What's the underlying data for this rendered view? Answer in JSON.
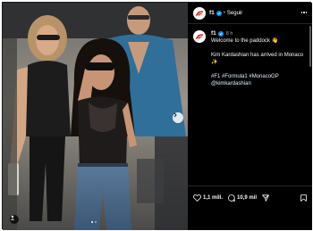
{
  "post": {
    "account": {
      "username": "f1",
      "follow_label": "Seguir",
      "separator": "•"
    },
    "caption": {
      "username": "f1",
      "time": "8 h",
      "line1": "Welcome to the paddock 👋",
      "line2": "Kim Kardashian has arrived in Monaco ✨",
      "hashtags": "#F1 #Formula1 #MonacoGP",
      "mention": "@kimkardashian"
    },
    "stats": {
      "likes": "1,1 mill.",
      "comments": "10,9 mil"
    }
  },
  "colors": {
    "verified": "#0095f6",
    "brand_red": "#e10600",
    "link": "#e0f1ff"
  },
  "icons": [
    "f1-logo-icon",
    "verified-icon",
    "more-options-icon",
    "chevron-right-icon",
    "user-tag-icon",
    "heart-icon",
    "comment-icon",
    "share-icon",
    "bookmark-icon"
  ]
}
